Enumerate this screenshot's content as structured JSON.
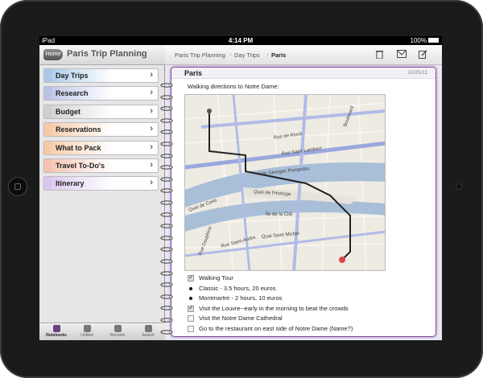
{
  "statusbar": {
    "carrier": "iPad",
    "time": "4:14 PM",
    "battery": "100%"
  },
  "notebook": {
    "home_label": "Home",
    "title": "Paris Trip Planning"
  },
  "sections": [
    {
      "label": "Day Trips",
      "color": "#a8c8ea"
    },
    {
      "label": "Research",
      "color": "#b9c3e6"
    },
    {
      "label": "Budget",
      "color": "#cfcfcf"
    },
    {
      "label": "Reservations",
      "color": "#f7c9a6"
    },
    {
      "label": "What to Pack",
      "color": "#f7c9a6"
    },
    {
      "label": "Travel To-Do's",
      "color": "#f6c2ad"
    },
    {
      "label": "Itinerary",
      "color": "#d9c6ee"
    }
  ],
  "tabbar": [
    {
      "label": "Notebooks",
      "icon": "notebook-icon"
    },
    {
      "label": "Unfiled",
      "icon": "unfiled-icon"
    },
    {
      "label": "Recents",
      "icon": "clock-icon"
    },
    {
      "label": "Search",
      "icon": "search-icon"
    }
  ],
  "breadcrumb": [
    "Paris Trip Planning",
    "Day Trips",
    "Paris"
  ],
  "toolbar": {
    "icons": [
      "trash-icon",
      "email-icon",
      "edit-icon"
    ]
  },
  "page": {
    "title": "Paris",
    "date": "10/25/11",
    "note": "Walking directions to Notre Dame:",
    "map_labels": [
      "Rue de Rivoli",
      "Rue Saint Lambert",
      "Voie Georges Pompidou",
      "Quai de l'Horloge",
      "Île de la Cité",
      "Rue Dauphine",
      "Quai de Conti",
      "Quai Saint Michel",
      "Rue Saint-Andre",
      "Boulevard"
    ]
  },
  "checklist": [
    {
      "type": "check",
      "checked": true,
      "text": "Walking Tour"
    },
    {
      "type": "bullet",
      "text": "Classic - 3.5 hours, 20 euros"
    },
    {
      "type": "bullet",
      "text": "Montmartre - 2 hours, 10 euros"
    },
    {
      "type": "check",
      "checked": true,
      "text": "Visit the Louvre--early in the morning to beat the crowds"
    },
    {
      "type": "check",
      "checked": false,
      "text": "Visit the Notre Dame Cathedral"
    },
    {
      "type": "check",
      "checked": false,
      "text": "Go to the restaurant on east side of Notre Dame (Name?)"
    }
  ]
}
